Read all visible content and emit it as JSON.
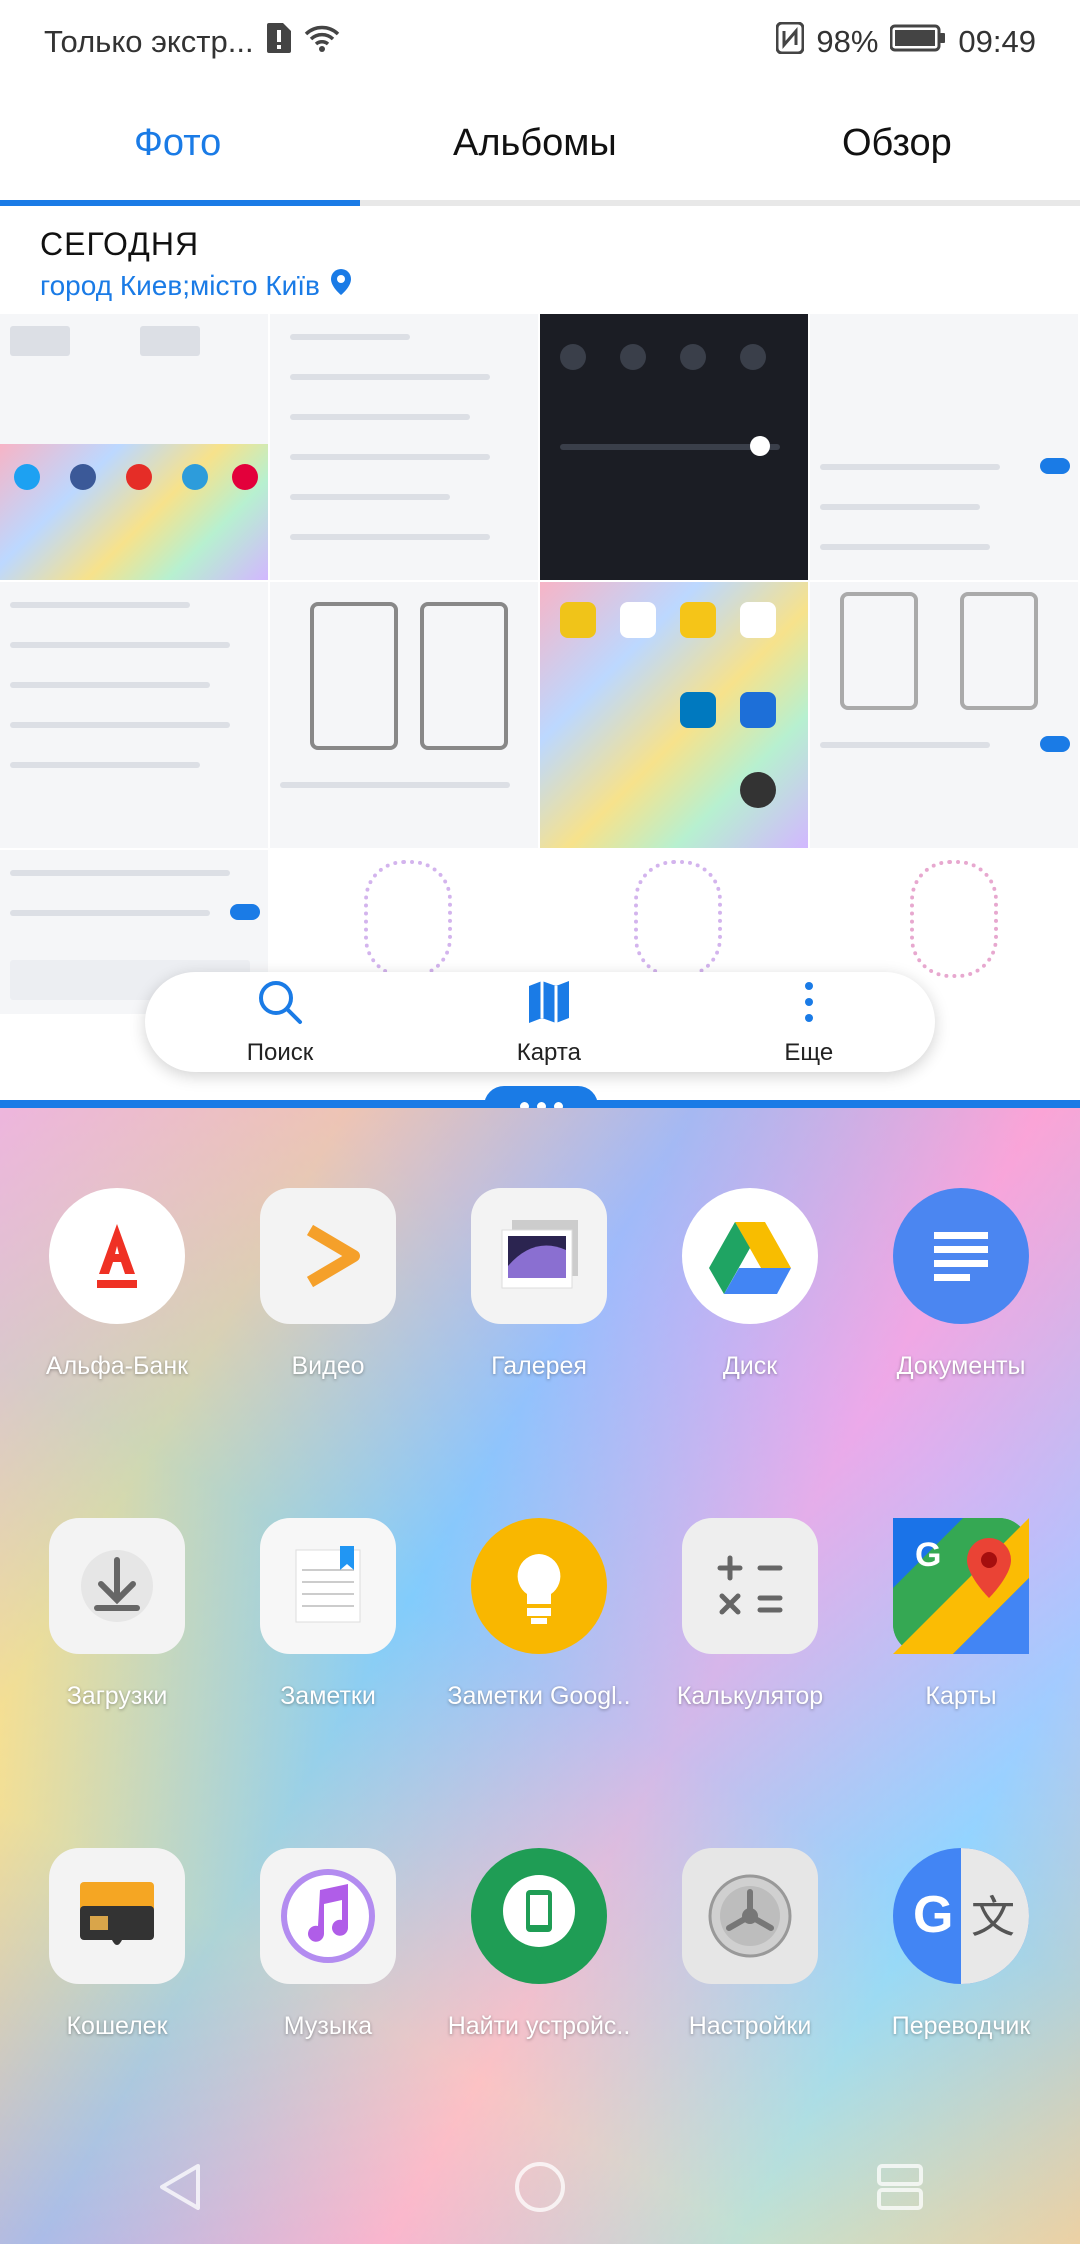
{
  "status_bar": {
    "carrier": "Только экстр...",
    "battery": "98%",
    "time": "09:49"
  },
  "tabs": [
    {
      "label": "Фото",
      "active": true
    },
    {
      "label": "Альбомы",
      "active": false
    },
    {
      "label": "Обзор",
      "active": false
    }
  ],
  "section": {
    "date_header": "СЕГОДНЯ",
    "location": "город Киев;місто Київ"
  },
  "toolbar": {
    "search_label": "Поиск",
    "map_label": "Карта",
    "more_label": "Еще"
  },
  "apps": [
    {
      "label": "Альфа-Банк",
      "icon": "alfa-bank-icon"
    },
    {
      "label": "Видео",
      "icon": "video-icon"
    },
    {
      "label": "Галерея",
      "icon": "gallery-icon"
    },
    {
      "label": "Диск",
      "icon": "drive-icon"
    },
    {
      "label": "Документы",
      "icon": "docs-icon"
    },
    {
      "label": "Загрузки",
      "icon": "downloads-icon"
    },
    {
      "label": "Заметки",
      "icon": "notes-icon"
    },
    {
      "label": "Заметки Googl..",
      "icon": "keep-icon"
    },
    {
      "label": "Калькулятор",
      "icon": "calculator-icon"
    },
    {
      "label": "Карты",
      "icon": "maps-icon"
    },
    {
      "label": "Кошелек",
      "icon": "wallet-icon"
    },
    {
      "label": "Музыка",
      "icon": "music-icon"
    },
    {
      "label": "Найти устройс..",
      "icon": "find-device-icon"
    },
    {
      "label": "Настройки",
      "icon": "settings-icon"
    },
    {
      "label": "Переводчик",
      "icon": "translate-icon"
    }
  ],
  "colors": {
    "accent": "#1a7be6",
    "alfa_red": "#ef3124",
    "video_orange": "#f5a02a",
    "docs_blue": "#4b86f1",
    "keep_yellow": "#f9b700",
    "find_green": "#1f9d55"
  }
}
